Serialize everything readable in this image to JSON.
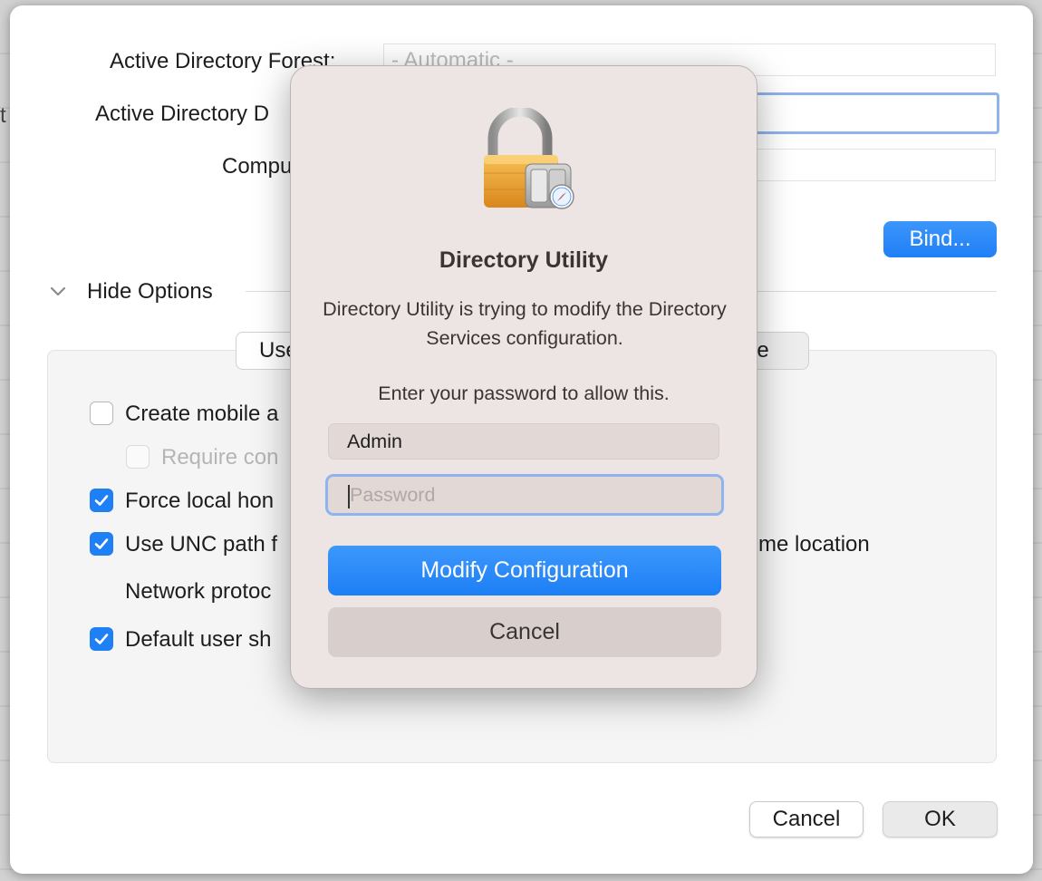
{
  "background": {
    "edge_text": "t"
  },
  "sheet": {
    "forest_label": "Active Directory Forest:",
    "forest_value": "- Automatic -",
    "domain_label": "Active Directory D",
    "computer_label": "Compu",
    "bind_button": "Bind...",
    "options_toggle": "Hide Options",
    "tab_left": "Use",
    "tab_right": "ive",
    "options": {
      "create_mobile": "Create mobile a",
      "require_con": "Require con",
      "force_local": "Force local hon",
      "use_unc": "Use UNC path f",
      "use_unc_tail": "me location",
      "network_proto": "Network protoc",
      "default_shell": "Default user sh"
    },
    "cancel_button": "Cancel",
    "ok_button": "OK"
  },
  "dialog": {
    "title": "Directory Utility",
    "message": "Directory Utility is trying to modify the Directory Services configuration.",
    "prompt": "Enter your password to allow this.",
    "username_value": "Admin",
    "password_placeholder": "Password",
    "primary_button": "Modify Configuration",
    "cancel_button": "Cancel",
    "icon": "lock-icon"
  },
  "checkbox_states": {
    "create_mobile": false,
    "require_con": false,
    "force_local": true,
    "use_unc": true,
    "default_shell": true
  },
  "colors": {
    "accent": "#1f7ff5",
    "focus_ring": "#8fb3ec",
    "dialog_bg": "#ede5e3"
  }
}
